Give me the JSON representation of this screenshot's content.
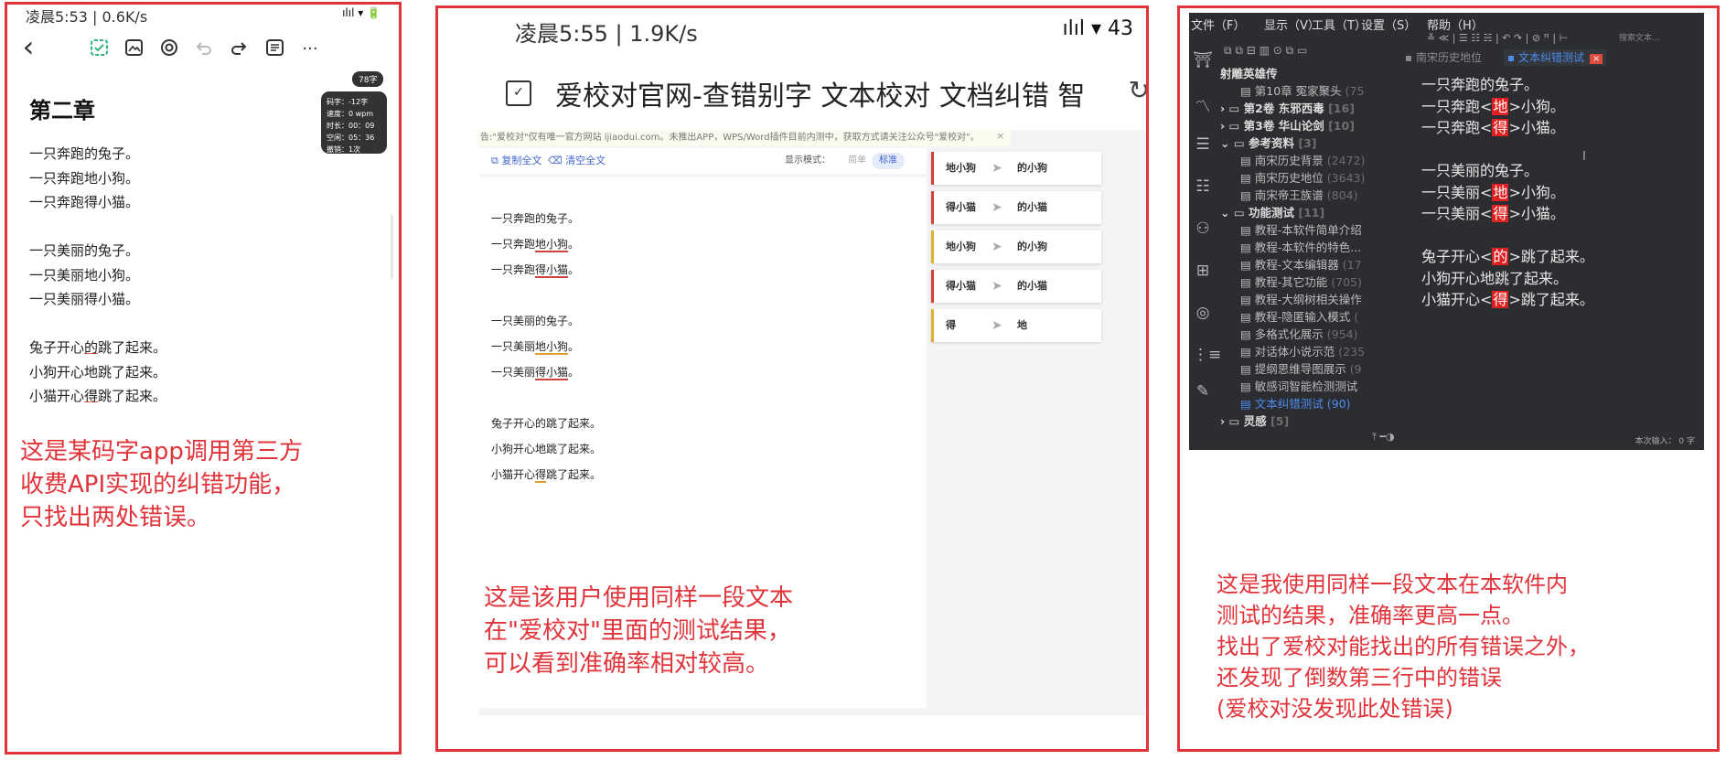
{
  "panel1": {
    "status_time": "凌晨5:53 | 0.6K/s",
    "status_right": "ılıl ▾ 🔋",
    "back_glyph": "‹",
    "more_glyph": "···",
    "chapter_title": "第二章",
    "word_badge": "78字",
    "stats": [
      "码字：-12字",
      "速度：0 wpm",
      "时长：00：09",
      "空闲：05：36",
      "撤销：1次"
    ],
    "lines": [
      {
        "pre": "一只奔跑的兔子。",
        "mark": "",
        "post": ""
      },
      {
        "pre": "一只奔跑地小狗。",
        "mark": "",
        "post": ""
      },
      {
        "pre": "一只奔跑得小猫。",
        "mark": "",
        "post": ""
      },
      {
        "pre": "",
        "mark": "",
        "post": ""
      },
      {
        "pre": "一只美丽的兔子。",
        "mark": "",
        "post": ""
      },
      {
        "pre": "一只美丽地小狗。",
        "mark": "",
        "post": ""
      },
      {
        "pre": "一只美丽得小猫。",
        "mark": "",
        "post": ""
      },
      {
        "pre": "",
        "mark": "",
        "post": ""
      },
      {
        "pre": "兔子开心",
        "mark": "的",
        "post": "跳了起来。"
      },
      {
        "pre": "小狗开心地跳了起来。",
        "mark": "",
        "post": ""
      },
      {
        "pre": "小猫开心",
        "mark": "得",
        "post": "跳了起来。"
      }
    ],
    "caption": [
      "这是某码字app调用第三方",
      "收费API实现的纠错功能，",
      "只找出两处错误。"
    ]
  },
  "panel2": {
    "status_time": "凌晨5:55 | 1.9K/s",
    "status_right": "ılıl ▾ 43",
    "page_title": "爱校对官网-查错别字 文本校对 文档纠错 智",
    "notice": "告:\"爱校对\"仅有唯一官方网站 ijiaodui.com。未推出APP，WPS/Word插件目前内测中，获取方式请关注公众号\"爱校对\"。",
    "notice_close": "×",
    "copy_all": "复制全文",
    "clear_all": "清空全文",
    "mode_label": "显示模式：",
    "mode_simple": "简单",
    "mode_standard": "标准",
    "editor_lines": [
      {
        "pre": "一只奔跑的兔子。",
        "mark": "",
        "post": "",
        "color": ""
      },
      {
        "pre": "一只奔跑",
        "mark": "地小狗",
        "post": "。",
        "color": "red"
      },
      {
        "pre": "一只奔跑",
        "mark": "得小猫",
        "post": "。",
        "color": "red"
      },
      {
        "pre": "一只美丽的兔子。",
        "mark": "",
        "post": "",
        "color": ""
      },
      {
        "pre": "一只美丽",
        "mark": "地小狗",
        "post": "。",
        "color": "orange"
      },
      {
        "pre": "一只美丽",
        "mark": "得小猫",
        "post": "。",
        "color": "red"
      },
      {
        "pre": "兔子开心的跳了起来。",
        "mark": "",
        "post": "",
        "color": ""
      },
      {
        "pre": "小狗开心地跳了起来。",
        "mark": "",
        "post": "",
        "color": ""
      },
      {
        "pre": "小猫开心",
        "mark": "得",
        "post": "跳了起来。",
        "color": "orange"
      }
    ],
    "suggestions": [
      {
        "from": "地小狗",
        "arrow": "➤",
        "to": "的小狗",
        "color": "#d0423a"
      },
      {
        "from": "得小猫",
        "arrow": "➤",
        "to": "的小猫",
        "color": "#d0423a"
      },
      {
        "from": "地小狗",
        "arrow": "➤",
        "to": "的小狗",
        "color": "#e0b030"
      },
      {
        "from": "得小猫",
        "arrow": "➤",
        "to": "的小猫",
        "color": "#d0423a"
      },
      {
        "from": "得",
        "arrow": "➤",
        "to": "地",
        "color": "#e0b030"
      }
    ],
    "caption": [
      "这是该用户使用同样一段文本",
      "在\"爱校对\"里面的测试结果，",
      "可以看到准确率相对较高。"
    ]
  },
  "panel3": {
    "menu": [
      "文件（F）",
      "显示（V）",
      "工具（T）",
      "设置（S）",
      "帮助（H）"
    ],
    "toolbar_glyphs": "≚ ≪ | ☰ ☷ ☵ | ↶ ↷ | ⊘ ꟸ | ⊢",
    "search_placeholder": "搜索文本...",
    "tree_tools": "⧉ ⧉ ⊟ ▥ ⊙ ⧉ ▭",
    "tabs": [
      {
        "label": "南宋历史地位",
        "active": false
      },
      {
        "label": "文本纠错测试",
        "active": true
      }
    ],
    "tab_close": "×",
    "tree": [
      {
        "label": "射雕英雄传",
        "count": "",
        "indent": 0,
        "bold": true,
        "active": false,
        "prefix": ""
      },
      {
        "label": "第10章 冤家聚头",
        "count": "(75",
        "indent": 2,
        "bold": false,
        "active": false,
        "prefix": "▤ "
      },
      {
        "label": "第2卷 东邪西毒",
        "count": "[16]",
        "indent": 0,
        "bold": true,
        "active": false,
        "prefix": "› ▭ "
      },
      {
        "label": "第3卷 华山论剑",
        "count": "[10]",
        "indent": 0,
        "bold": true,
        "active": false,
        "prefix": "› ▭ "
      },
      {
        "label": "参考资料",
        "count": "[3]",
        "indent": 0,
        "bold": true,
        "active": false,
        "prefix": "⌄ ▭ "
      },
      {
        "label": "南宋历史背景",
        "count": "(2472)",
        "indent": 2,
        "bold": false,
        "active": false,
        "prefix": "▤ "
      },
      {
        "label": "南宋历史地位",
        "count": "(3643)",
        "indent": 2,
        "bold": false,
        "active": false,
        "prefix": "▤ "
      },
      {
        "label": "南宋帝王族谱",
        "count": "(804)",
        "indent": 2,
        "bold": false,
        "active": false,
        "prefix": "▤ "
      },
      {
        "label": "功能测试",
        "count": "[11]",
        "indent": 0,
        "bold": true,
        "active": false,
        "prefix": "⌄ ▭ "
      },
      {
        "label": "教程-本软件简单介绍",
        "count": "",
        "indent": 2,
        "bold": false,
        "active": false,
        "prefix": "▤ "
      },
      {
        "label": "教程-本软件的特色...",
        "count": "",
        "indent": 2,
        "bold": false,
        "active": false,
        "prefix": "▤ "
      },
      {
        "label": "教程-文本编辑器",
        "count": "(17",
        "indent": 2,
        "bold": false,
        "active": false,
        "prefix": "▤ "
      },
      {
        "label": "教程-其它功能",
        "count": "(705)",
        "indent": 2,
        "bold": false,
        "active": false,
        "prefix": "▤ "
      },
      {
        "label": "教程-大纲树相关操作",
        "count": "",
        "indent": 2,
        "bold": false,
        "active": false,
        "prefix": "▤ "
      },
      {
        "label": "教程-隐匿输入模式",
        "count": "(",
        "indent": 2,
        "bold": false,
        "active": false,
        "prefix": "▤ "
      },
      {
        "label": "多格式化展示",
        "count": "(954)",
        "indent": 2,
        "bold": false,
        "active": false,
        "prefix": "▤ "
      },
      {
        "label": "对话体小说示范",
        "count": "(235",
        "indent": 2,
        "bold": false,
        "active": false,
        "prefix": "▤ "
      },
      {
        "label": "提纲思维导图展示",
        "count": "(9",
        "indent": 2,
        "bold": false,
        "active": false,
        "prefix": "▤ "
      },
      {
        "label": "敏感词智能检测测试",
        "count": "",
        "indent": 2,
        "bold": false,
        "active": false,
        "prefix": "▤ "
      },
      {
        "label": "文本纠错测试",
        "count": "(90)",
        "indent": 2,
        "bold": false,
        "active": true,
        "prefix": "▤ "
      },
      {
        "label": "灵感",
        "count": "[5]",
        "indent": 0,
        "bold": true,
        "active": false,
        "prefix": "› ▭ "
      }
    ],
    "content": [
      {
        "pre": "一只奔跑的兔子。",
        "mark": "",
        "post": ""
      },
      {
        "pre": "一只奔跑<",
        "mark": "地",
        "post": ">小狗。"
      },
      {
        "pre": "一只奔跑<",
        "mark": "得",
        "post": ">小猫。"
      },
      {
        "pre": "",
        "mark": "",
        "post": ""
      },
      {
        "pre": "一只美丽的兔子。",
        "mark": "",
        "post": ""
      },
      {
        "pre": "一只美丽<",
        "mark": "地",
        "post": ">小狗。"
      },
      {
        "pre": "一只美丽<",
        "mark": "得",
        "post": ">小猫。"
      },
      {
        "pre": "",
        "mark": "",
        "post": ""
      },
      {
        "pre": "兔子开心<",
        "mark": "的",
        "post": ">跳了起来。"
      },
      {
        "pre": "小狗开心地跳了起来。",
        "mark": "",
        "post": ""
      },
      {
        "pre": "小猫开心<",
        "mark": "得",
        "post": ">跳了起来。"
      }
    ],
    "bottom_tools": "⤒ ━◑",
    "word_input": "本次输入： 0 字",
    "caption": [
      "这是我使用同样一段文本在本软件内",
      "测试的结果，准确率更高一点。",
      "找出了爱校对能找出的所有错误之外，",
      "还发现了倒数第三行中的错误",
      "(爱校对没发现此处错误)"
    ]
  }
}
